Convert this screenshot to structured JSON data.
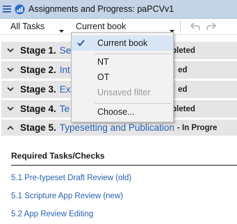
{
  "window": {
    "title": "Assignments and Progress: paPCVv1"
  },
  "toolbar": {
    "filter_value": "All Tasks",
    "scope_value": "Current book"
  },
  "stages": [
    {
      "prefix": "Stage 1.",
      "name": "Se",
      "status": "pleted",
      "expanded": false
    },
    {
      "prefix": "Stage 2.",
      "name": "Int",
      "status": "ed",
      "expanded": false
    },
    {
      "prefix": "Stage 3.",
      "name": "Ex",
      "status": "ed",
      "expanded": false
    },
    {
      "prefix": "Stage 4.",
      "name": "Te",
      "status": "pleted",
      "expanded": false
    },
    {
      "prefix": "Stage 5.",
      "name": "Typesetting and Publication",
      "status": "- In Progre",
      "expanded": true
    }
  ],
  "stage5_content": {
    "heading": "Required Tasks/Checks",
    "tasks": [
      "5.1 Pre-typeset Draft Review (old)",
      "5.1 Scripture App Review (new)",
      "5.2 App Review Editing"
    ]
  },
  "scope_dropdown": {
    "items": [
      {
        "label": "Current book",
        "selected": true,
        "disabled": false
      },
      {
        "label": "NT",
        "selected": false,
        "disabled": false
      },
      {
        "label": "OT",
        "selected": false,
        "disabled": false
      },
      {
        "label": "Unsaved filter",
        "selected": false,
        "disabled": true
      },
      {
        "label": "Choose...",
        "selected": false,
        "disabled": false
      }
    ]
  },
  "colors": {
    "titlebar_bg": "#c4d3e6",
    "stage_header_bg": "#e5e5e5",
    "link_blue": "#2660b8",
    "menu_selected_bg": "#d8e6f5"
  },
  "icons": {
    "menu": "hamburger-icon",
    "app": "app-logo-icon",
    "undo": "undo-icon",
    "redo": "redo-icon",
    "collapsed": "chevron-down-icon",
    "expanded": "chevron-up-icon",
    "check": "checkmark-icon"
  }
}
